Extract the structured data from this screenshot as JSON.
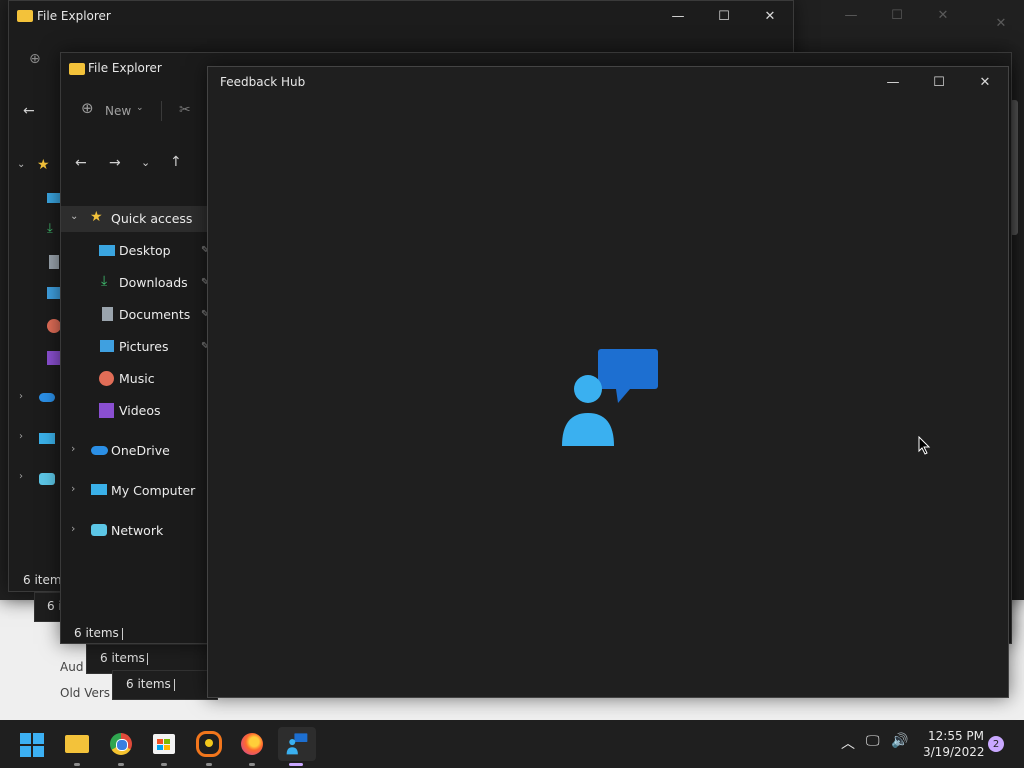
{
  "windows": {
    "back": {
      "title": "File Explorer",
      "status": "6 items"
    },
    "mid": {
      "title": "File Explorer",
      "new_label": "New",
      "status": "6 items",
      "quick_access": "Quick access",
      "items": [
        "Desktop",
        "Downloads",
        "Documents",
        "Pictures",
        "Music",
        "Videos"
      ],
      "onedrive": "OneDrive",
      "mycomputer": "My Computer",
      "network": "Network"
    },
    "stacked_status": [
      "6 items",
      "6 items",
      "6 items"
    ],
    "behind_texts": [
      "Aud",
      "Old Vers"
    ],
    "feedback": {
      "title": "Feedback Hub"
    }
  },
  "taskbar": {
    "time": "12:55 PM",
    "date": "3/19/2022",
    "notification_count": "2"
  },
  "colors": {
    "window_bg": "#1b1b1b",
    "taskbar_bg": "#1f1f1f",
    "accent": "#2b8fe6",
    "badge": "#c9a8ff"
  }
}
